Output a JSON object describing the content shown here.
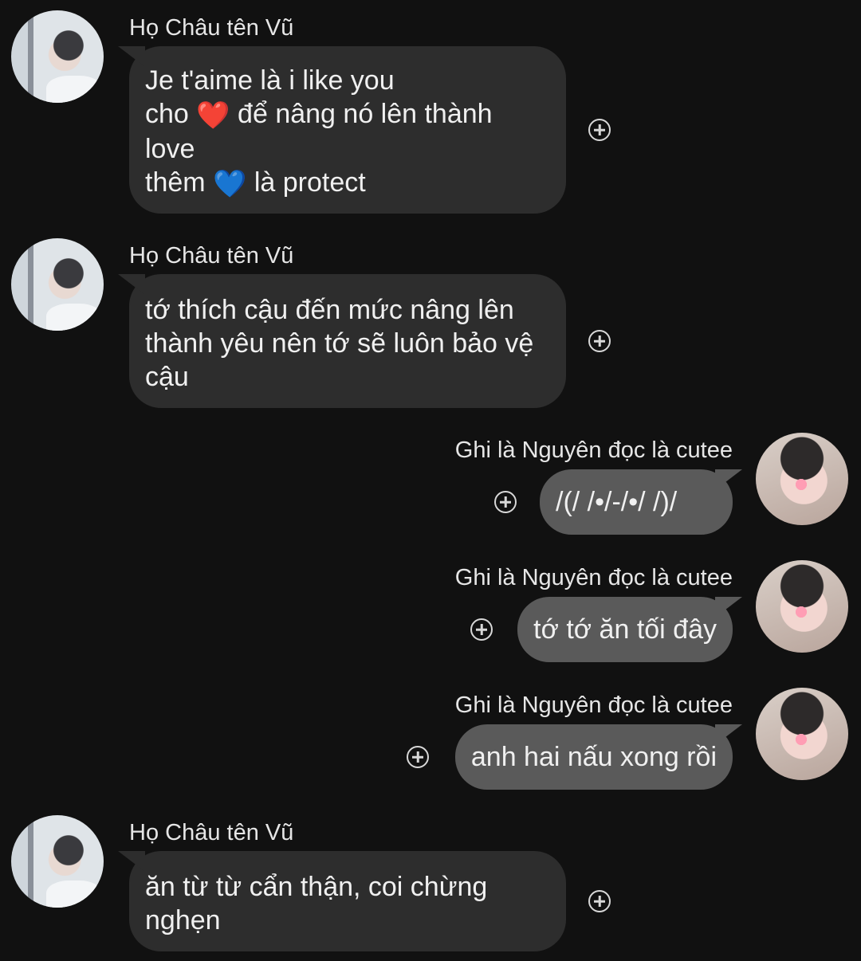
{
  "messages": [
    {
      "sender": "Họ Châu tên Vũ",
      "side": "left",
      "lines": [
        "Je t'aime là i like you",
        "cho ❤️ để nâng nó lên thành",
        "love",
        "thêm 💙 là protect"
      ]
    },
    {
      "sender": "Họ Châu tên Vũ",
      "side": "left",
      "lines": [
        "tớ thích cậu đến mức nâng lên",
        "thành yêu nên tớ sẽ luôn bảo vệ",
        "cậu"
      ]
    },
    {
      "sender": "Ghi là Nguyên đọc là cutee",
      "side": "right",
      "lines": [
        "/(/ /•/-/•/ /)/"
      ]
    },
    {
      "sender": "Ghi là Nguyên đọc là cutee",
      "side": "right",
      "lines": [
        "tớ tớ ăn tối đây"
      ]
    },
    {
      "sender": "Ghi là Nguyên đọc là cutee",
      "side": "right",
      "lines": [
        "anh hai nấu xong rồi"
      ]
    },
    {
      "sender": "Họ Châu tên Vũ",
      "side": "left",
      "lines": [
        "ăn từ từ cẩn thận, coi chừng",
        "nghẹn"
      ]
    }
  ],
  "heart_colors": {
    "red": "#e0242c",
    "blue": "#2f8fe6"
  }
}
